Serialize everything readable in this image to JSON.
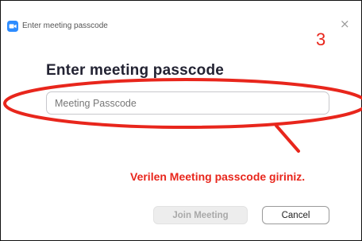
{
  "window": {
    "title": "Enter meeting passcode",
    "close_glyph": "×",
    "app_icon": "zoom-camera-icon"
  },
  "annotation": {
    "step_number": "3",
    "note": "Verilen Meeting passcode giriniz.",
    "color": "#e8261c"
  },
  "dialog": {
    "heading": "Enter meeting passcode",
    "passcode_input": {
      "value": "",
      "placeholder": "Meeting Passcode"
    },
    "join_button_label": "Join Meeting",
    "cancel_button_label": "Cancel"
  },
  "colors": {
    "brand_blue": "#2d8cff",
    "heading": "#232333"
  }
}
